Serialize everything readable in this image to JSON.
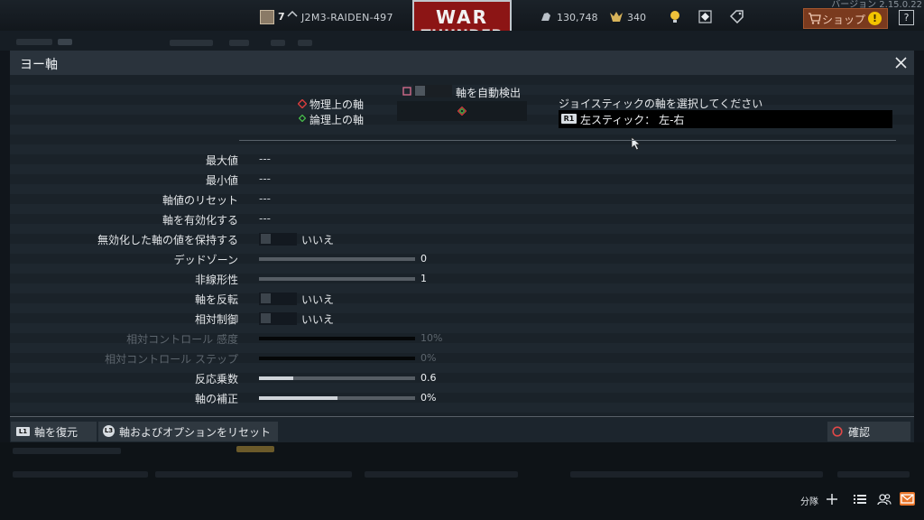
{
  "topbar": {
    "version": "バージョン 2.15.0.22",
    "rank": "7",
    "username": "J2M3-RAIDEN-497",
    "logo_line1": "WAR",
    "logo_line2": "THUNDER",
    "silver_lions": "130,748",
    "golden_eagles": "340",
    "shop_label": "ショップ",
    "shop_alert": "!",
    "help_label": "?"
  },
  "modal": {
    "title": "ヨー軸",
    "indicators": {
      "physical_axis_label": "物理上の軸",
      "logical_axis_label": "論理上の軸",
      "auto_detect_label": "軸を自動検出",
      "joystick_prompt": "ジョイスティックの軸を選択してください",
      "joystick_button_badge": "R1",
      "joystick_value": "左スティック：  左-右"
    },
    "rows": [
      {
        "label": "最大値",
        "value": "---"
      },
      {
        "label": "最小値",
        "value": "---"
      },
      {
        "label": "軸値のリセット",
        "value": "---"
      },
      {
        "label": "軸を有効化する",
        "value": "---"
      },
      {
        "label": "無効化した軸の値を保持する",
        "value": "いいえ"
      },
      {
        "label": "デッドゾーン",
        "value": "0",
        "fraction": 0
      },
      {
        "label": "非線形性",
        "value": "1",
        "fraction": 0
      },
      {
        "label": "軸を反転",
        "value": "いいえ"
      },
      {
        "label": "相対制御",
        "value": "いいえ"
      },
      {
        "label": "相対コントロール 感度",
        "value": "10%",
        "fraction": 0
      },
      {
        "label": "相対コントロール ステップ",
        "value": "0%",
        "fraction": 0
      },
      {
        "label": "反応乗数",
        "value": "0.6",
        "fraction": 0.22
      },
      {
        "label": "軸の補正",
        "value": "0%",
        "fraction": 0.5
      }
    ],
    "footer": {
      "restore_badge": "L1",
      "restore_label": "軸を復元",
      "reset_badge": "L3",
      "reset_label": "軸およびオプションをリセット",
      "confirm_label": "確認"
    }
  },
  "statusbar": {
    "squad_label": "分隊"
  },
  "colors": {
    "logo_red": "#8c1515",
    "shop_orange": "#7a3a1e",
    "alert_yellow": "#f1c400",
    "physical_axis_red": "#d23c3c",
    "logical_axis_green": "#46b84a",
    "confirm_red": "#e04848",
    "mail_orange": "#e8752a"
  }
}
